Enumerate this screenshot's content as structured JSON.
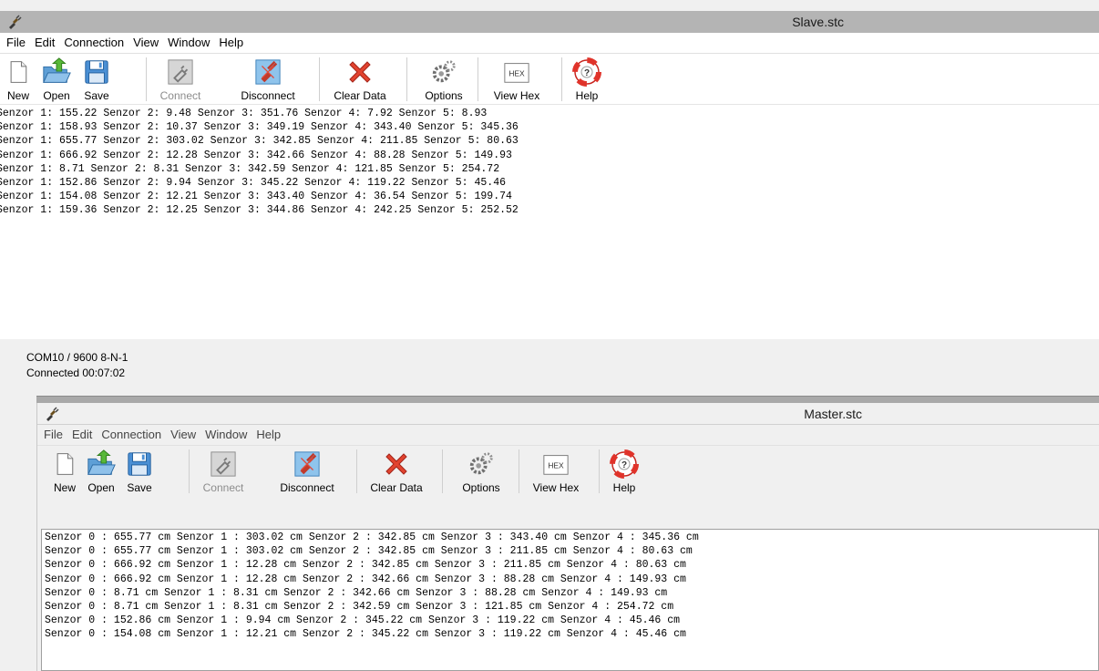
{
  "slave": {
    "title": "Slave.stc",
    "menu": [
      "File",
      "Edit",
      "Connection",
      "View",
      "Window",
      "Help"
    ],
    "toolbar": {
      "new": "New",
      "open": "Open",
      "save": "Save",
      "connect": "Connect",
      "disconnect": "Disconnect",
      "clear": "Clear Data",
      "options": "Options",
      "viewhex": "View Hex",
      "hex_badge": "HEX",
      "help": "Help"
    },
    "lines": [
      "Senzor 1: 155.22 Senzor 2: 9.48 Senzor 3: 351.76 Senzor 4: 7.92 Senzor 5: 8.93",
      "Senzor 1: 158.93 Senzor 2: 10.37 Senzor 3: 349.19 Senzor 4: 343.40 Senzor 5: 345.36",
      "Senzor 1: 655.77 Senzor 2: 303.02 Senzor 3: 342.85 Senzor 4: 211.85 Senzor 5: 80.63",
      "Senzor 1: 666.92 Senzor 2: 12.28 Senzor 3: 342.66 Senzor 4: 88.28 Senzor 5: 149.93",
      "Senzor 1: 8.71 Senzor 2: 8.31 Senzor 3: 342.59 Senzor 4: 121.85 Senzor 5: 254.72",
      "Senzor 1: 152.86 Senzor 2: 9.94 Senzor 3: 345.22 Senzor 4: 119.22 Senzor 5: 45.46",
      "Senzor 1: 154.08 Senzor 2: 12.21 Senzor 3: 343.40 Senzor 4: 36.54 Senzor 5: 199.74",
      "Senzor 1: 159.36 Senzor 2: 12.25 Senzor 3: 344.86 Senzor 4: 242.25 Senzor 5: 252.52"
    ],
    "status": {
      "port": "COM10 / 9600 8-N-1",
      "connection": "Connected 00:07:02"
    }
  },
  "master": {
    "title": "Master.stc",
    "menu": [
      "File",
      "Edit",
      "Connection",
      "View",
      "Window",
      "Help"
    ],
    "toolbar": {
      "new": "New",
      "open": "Open",
      "save": "Save",
      "connect": "Connect",
      "disconnect": "Disconnect",
      "clear": "Clear Data",
      "options": "Options",
      "viewhex": "View Hex",
      "hex_badge": "HEX",
      "help": "Help"
    },
    "lines": [
      "Senzor 0 : 655.77 cm Senzor 1 : 303.02 cm Senzor 2 : 342.85 cm Senzor 3 : 343.40 cm Senzor 4 : 345.36 cm",
      "Senzor 0 : 655.77 cm Senzor 1 : 303.02 cm Senzor 2 : 342.85 cm Senzor 3 : 211.85 cm Senzor 4 : 80.63 cm",
      "Senzor 0 : 666.92 cm Senzor 1 : 12.28 cm Senzor 2 : 342.85 cm Senzor 3 : 211.85 cm Senzor 4 : 80.63 cm",
      "Senzor 0 : 666.92 cm Senzor 1 : 12.28 cm Senzor 2 : 342.66 cm Senzor 3 : 88.28 cm Senzor 4 : 149.93 cm",
      "Senzor 0 : 8.71 cm Senzor 1 : 8.31 cm Senzor 2 : 342.66 cm Senzor 3 : 88.28 cm Senzor 4 : 149.93 cm",
      "Senzor 0 : 8.71 cm Senzor 1 : 8.31 cm Senzor 2 : 342.59 cm Senzor 3 : 121.85 cm Senzor 4 : 254.72 cm",
      "Senzor 0 : 152.86 cm Senzor 1 : 9.94 cm Senzor 2 : 345.22 cm Senzor 3 : 119.22 cm Senzor 4 : 45.46 cm",
      "Senzor 0 : 154.08 cm Senzor 1 : 12.21 cm Senzor 2 : 345.22 cm Senzor 3 : 119.22 cm Senzor 4 : 45.46 cm"
    ]
  }
}
